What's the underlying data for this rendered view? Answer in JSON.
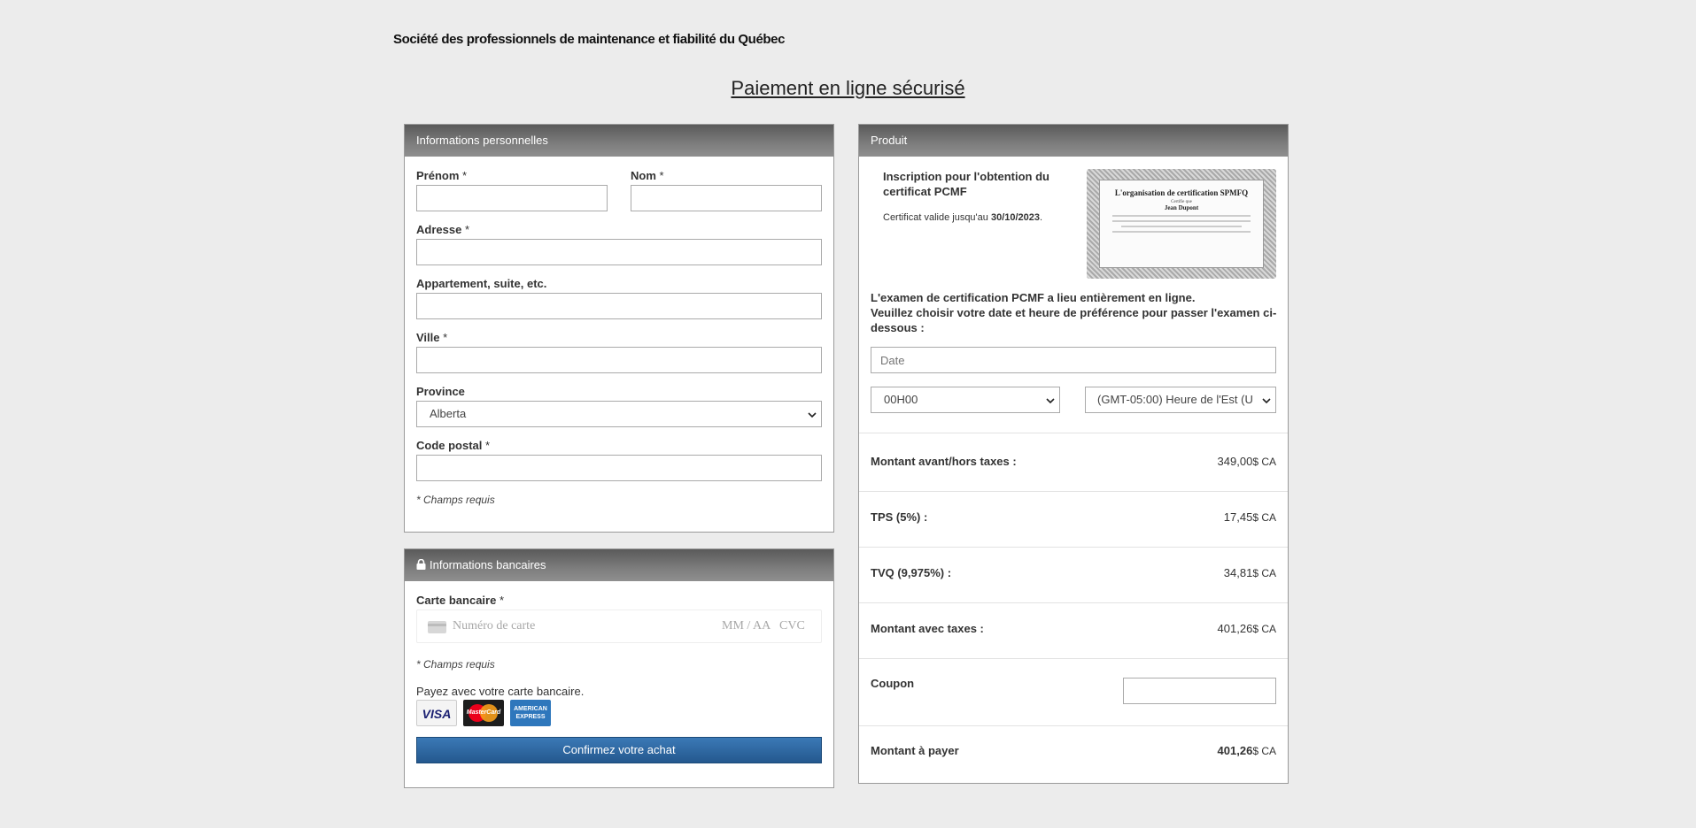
{
  "header": {
    "org_name": "Société des professionnels de maintenance et fiabilité du Québec",
    "page_title": "Paiement en ligne sécurisé"
  },
  "personal": {
    "title": "Informations personnelles",
    "prenom": {
      "label": "Prénom",
      "req": "*",
      "value": ""
    },
    "nom": {
      "label": "Nom",
      "req": "*",
      "value": ""
    },
    "adresse": {
      "label": "Adresse",
      "req": "*",
      "value": ""
    },
    "appartement": {
      "label": "Appartement, suite, etc.",
      "value": ""
    },
    "ville": {
      "label": "Ville",
      "req": "*",
      "value": ""
    },
    "province": {
      "label": "Province",
      "selected": "Alberta"
    },
    "code_postal": {
      "label": "Code postal",
      "req": "*",
      "value": ""
    },
    "required_note": "* Champs requis"
  },
  "bank": {
    "title": "Informations bancaires",
    "card_label": "Carte bancaire",
    "req": "*",
    "card_placeholder": "Numéro de carte",
    "expiry_placeholder": "MM / AA",
    "cvc_placeholder": "CVC",
    "required_note": "* Champs requis",
    "pay_with": "Payez avec votre carte bancaire.",
    "card_logos": {
      "visa": "VISA",
      "mastercard": "MasterCard",
      "amex_1": "AMERICAN",
      "amex_2": "EXPRESS"
    },
    "confirm_label": "Confirmez votre achat",
    "confirm_color": "#2d6aa6"
  },
  "product": {
    "title": "Produit",
    "name": "Inscription pour l'obtention du certificat PCMF",
    "validity_prefix": "Certificat valide jusqu'au",
    "validity_date": "30/10/2023",
    "validity_suffix": ".",
    "certificate": {
      "title": "L'organisation de certification SPMFQ",
      "subtitle": "Certifie que",
      "name": "Jean Dupont"
    },
    "exam_info_1": "L'examen de certification PCMF a lieu entièrement en ligne.",
    "exam_info_2": "Veuillez choisir votre date et heure de préférence pour passer l'examen ci-dessous :",
    "date_placeholder": "Date",
    "time_selected": "00H00",
    "timezone_selected": "(GMT-05:00) Heure de l'Est (U",
    "rows": {
      "subtotal": {
        "label": "Montant avant/hors taxes :",
        "amount": "349,00",
        "currency": "$ CA"
      },
      "tps": {
        "label": "TPS (5%) :",
        "amount": "17,45",
        "currency": "$ CA"
      },
      "tvq": {
        "label": "TVQ (9,975%) :",
        "amount": "34,81",
        "currency": "$ CA"
      },
      "total_taxes": {
        "label": "Montant avec taxes :",
        "amount": "401,26",
        "currency": "$ CA"
      },
      "coupon": {
        "label": "Coupon",
        "value": ""
      },
      "to_pay": {
        "label": "Montant à payer",
        "amount": "401,26",
        "currency": "$ CA"
      }
    }
  }
}
